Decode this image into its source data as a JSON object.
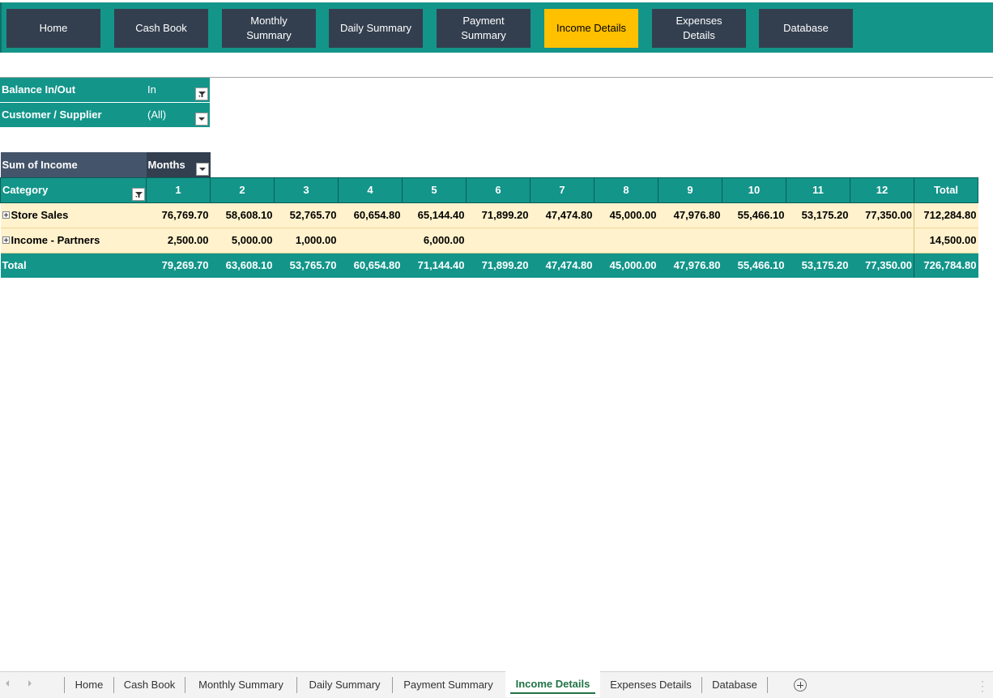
{
  "nav": {
    "buttons": [
      {
        "label": "Home"
      },
      {
        "label": "Cash Book"
      },
      {
        "label": "Monthly\nSummary"
      },
      {
        "label": "Daily Summary"
      },
      {
        "label": "Payment\nSummary"
      },
      {
        "label": "Income Details"
      },
      {
        "label": "Expenses\nDetails"
      },
      {
        "label": "Database"
      }
    ],
    "active_label": "Income Details"
  },
  "filters": {
    "balance": {
      "label": "Balance In/Out",
      "value": "In"
    },
    "customer": {
      "label": "Customer / Supplier",
      "value": "(All)"
    }
  },
  "pivot": {
    "value_field": "Sum of Income",
    "column_field": "Months",
    "row_field": "Category",
    "columns": [
      "1",
      "2",
      "3",
      "4",
      "5",
      "6",
      "7",
      "8",
      "9",
      "10",
      "11",
      "12"
    ],
    "total_label": "Total",
    "rows": [
      {
        "label": "Store Sales",
        "cells": [
          "76,769.70",
          "58,608.10",
          "52,765.70",
          "60,654.80",
          "65,144.40",
          "71,899.20",
          "47,474.80",
          "45,000.00",
          "47,976.80",
          "55,466.10",
          "53,175.20",
          "77,350.00"
        ],
        "total": "712,284.80"
      },
      {
        "label": "Income - Partners",
        "cells": [
          "2,500.00",
          "5,000.00",
          "1,000.00",
          "",
          "6,000.00",
          "",
          "",
          "",
          "",
          "",
          "",
          ""
        ],
        "total": "14,500.00"
      }
    ],
    "grand_total": {
      "label": "Total",
      "cells": [
        "79,269.70",
        "63,608.10",
        "53,765.70",
        "60,654.80",
        "71,144.40",
        "71,899.20",
        "47,474.80",
        "45,000.00",
        "47,976.80",
        "55,466.10",
        "53,175.20",
        "77,350.00"
      ],
      "total": "726,784.80"
    }
  },
  "sheet_tabs": [
    {
      "label": "Home"
    },
    {
      "label": "Cash Book"
    },
    {
      "label": "Monthly Summary"
    },
    {
      "label": "Daily Summary"
    },
    {
      "label": "Payment Summary"
    },
    {
      "label": "Income Details"
    },
    {
      "label": "Expenses Details"
    },
    {
      "label": "Database"
    }
  ],
  "active_sheet": "Income Details",
  "colors": {
    "teal": "#13958a",
    "navy": "#333f4f",
    "accent": "#ffc000",
    "band": "#fff2cc",
    "tab_active": "#217346"
  }
}
